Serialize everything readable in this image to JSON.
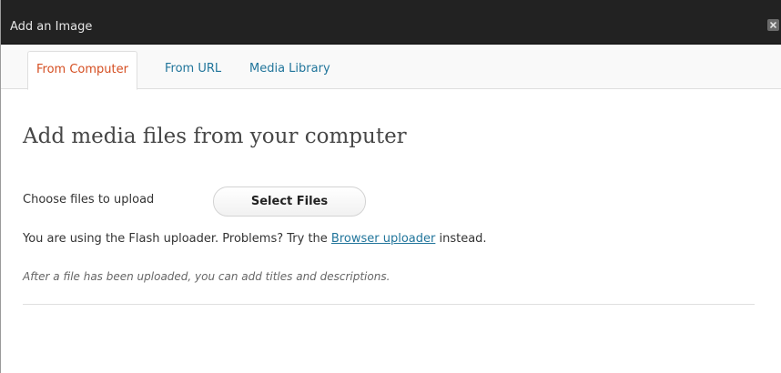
{
  "window": {
    "title": "Add an Image",
    "close_icon": "close-icon"
  },
  "tabs": [
    {
      "label": "From Computer",
      "active": true
    },
    {
      "label": "From URL",
      "active": false
    },
    {
      "label": "Media Library",
      "active": false
    }
  ],
  "main": {
    "heading": "Add media files from your computer",
    "choose_label": "Choose files to upload",
    "select_button": "Select Files",
    "flash_text_before": "You are using the Flash uploader. Problems? Try the ",
    "flash_link": "Browser uploader",
    "flash_text_after": " instead.",
    "note": "After a file has been uploaded, you can add titles and descriptions."
  },
  "colors": {
    "titlebar": "#222222",
    "active_tab": "#d54e21",
    "link": "#21759b"
  }
}
